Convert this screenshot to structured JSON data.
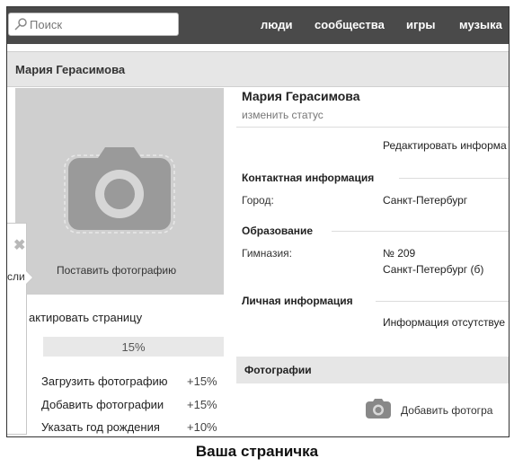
{
  "search": {
    "placeholder": "Поиск",
    "icon": "search-icon"
  },
  "nav": [
    "люди",
    "сообщества",
    "игры",
    "музыка"
  ],
  "header": {
    "name": "Мария Герасимова"
  },
  "left": {
    "set_photo": "Поставить фотографию",
    "popup_text": "сли",
    "edit_page": "актировать страницу",
    "progress_label": "15%",
    "progress_value": 15,
    "tasks": [
      {
        "label": "Загрузить фотографию",
        "pct": "+15%"
      },
      {
        "label": "Добавить фотографии",
        "pct": "+15%"
      },
      {
        "label": "Указать год рождения",
        "pct": "+10%"
      }
    ]
  },
  "profile": {
    "name": "Мария Герасимова",
    "status": "изменить статус",
    "edit_info": "Редактировать информа",
    "contacts_title": "Контактная информация",
    "city_label": "Город:",
    "city_value": "Санкт-Петербург",
    "education_title": "Образование",
    "school_label": "Гимназия:",
    "school_value": "№ 209",
    "school_city": "Санкт-Петербург (б)",
    "personal_title": "Личная информация",
    "personal_value": "Информация отсутствуе"
  },
  "photos": {
    "title": "Фотографии",
    "add": "Добавить фотогра"
  },
  "caption": "Ваша страничка"
}
